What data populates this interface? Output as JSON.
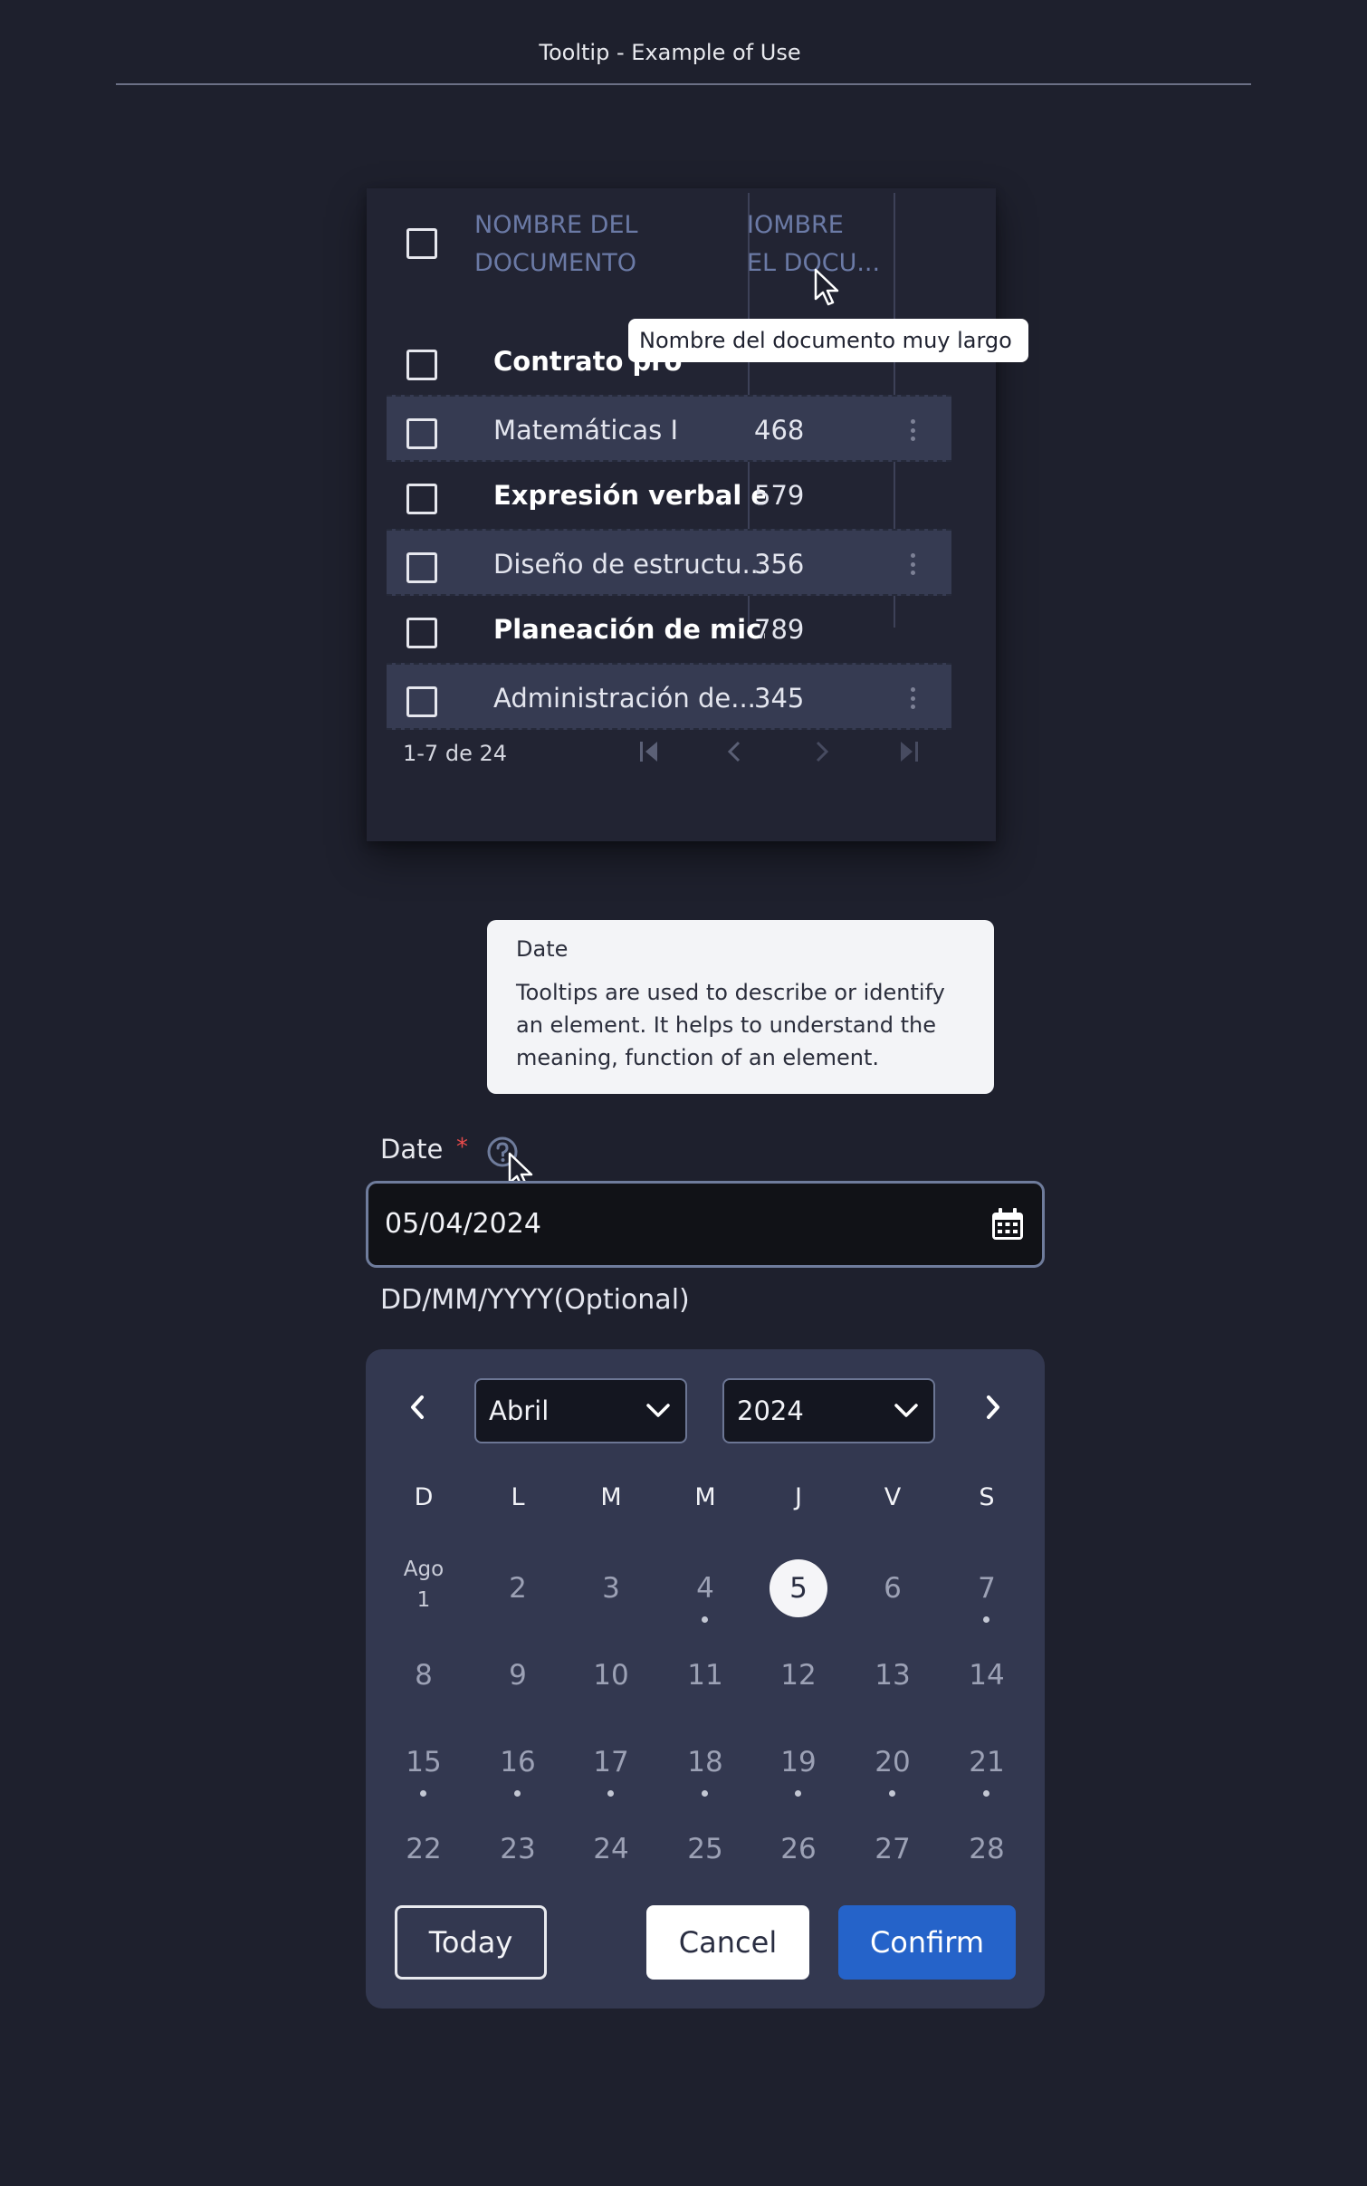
{
  "page": {
    "title": "Tooltip - Example of Use"
  },
  "table": {
    "headers": [
      {
        "line1": "NOMBRE DEL",
        "line2": "DOCUMENTO"
      },
      {
        "line1": "IOMBRE",
        "line2": "EL DOCU..."
      }
    ],
    "rows": [
      {
        "name": "Contrato pro",
        "value": ""
      },
      {
        "name": "Matemáticas I",
        "value": "468"
      },
      {
        "name": "Expresión verbal e...",
        "value": "579"
      },
      {
        "name": "Diseño de estructu...",
        "value": "356"
      },
      {
        "name": "Planeación de mic...",
        "value": "789"
      },
      {
        "name": "Administración de...",
        "value": "345"
      }
    ],
    "pagination": {
      "range": "1-7 de 24"
    },
    "tooltip": "Nombre del documento muy largo"
  },
  "date_field": {
    "tooltip_title": "Date",
    "tooltip_body": "Tooltips are used to describe or identify an element. It helps to understand the meaning, function of an element.",
    "label": "Date",
    "required_mark": "*",
    "value": "05/04/2024",
    "hint": "DD/MM/YYYY(Optional)"
  },
  "calendar": {
    "month": "Abril",
    "year": "2024",
    "weekdays": [
      "D",
      "L",
      "M",
      "M",
      "J",
      "V",
      "S"
    ],
    "first_day": {
      "month_label": "Ago",
      "day": "1"
    },
    "weeks": [
      [
        "",
        "2",
        "3",
        "4",
        "5",
        "6",
        "7"
      ],
      [
        "8",
        "9",
        "10",
        "11",
        "12",
        "13",
        "14"
      ],
      [
        "15",
        "16",
        "17",
        "18",
        "19",
        "20",
        "21"
      ],
      [
        "22",
        "23",
        "24",
        "25",
        "26",
        "27",
        "28"
      ]
    ],
    "selected_day": "5",
    "dotted_days": [
      "4",
      "7",
      "15",
      "16",
      "17",
      "18",
      "19",
      "20",
      "21"
    ],
    "buttons": {
      "today": "Today",
      "cancel": "Cancel",
      "confirm": "Confirm"
    }
  },
  "colors": {
    "background": "#1e202d",
    "accent": "#2563c9",
    "required": "#e94b4b"
  }
}
